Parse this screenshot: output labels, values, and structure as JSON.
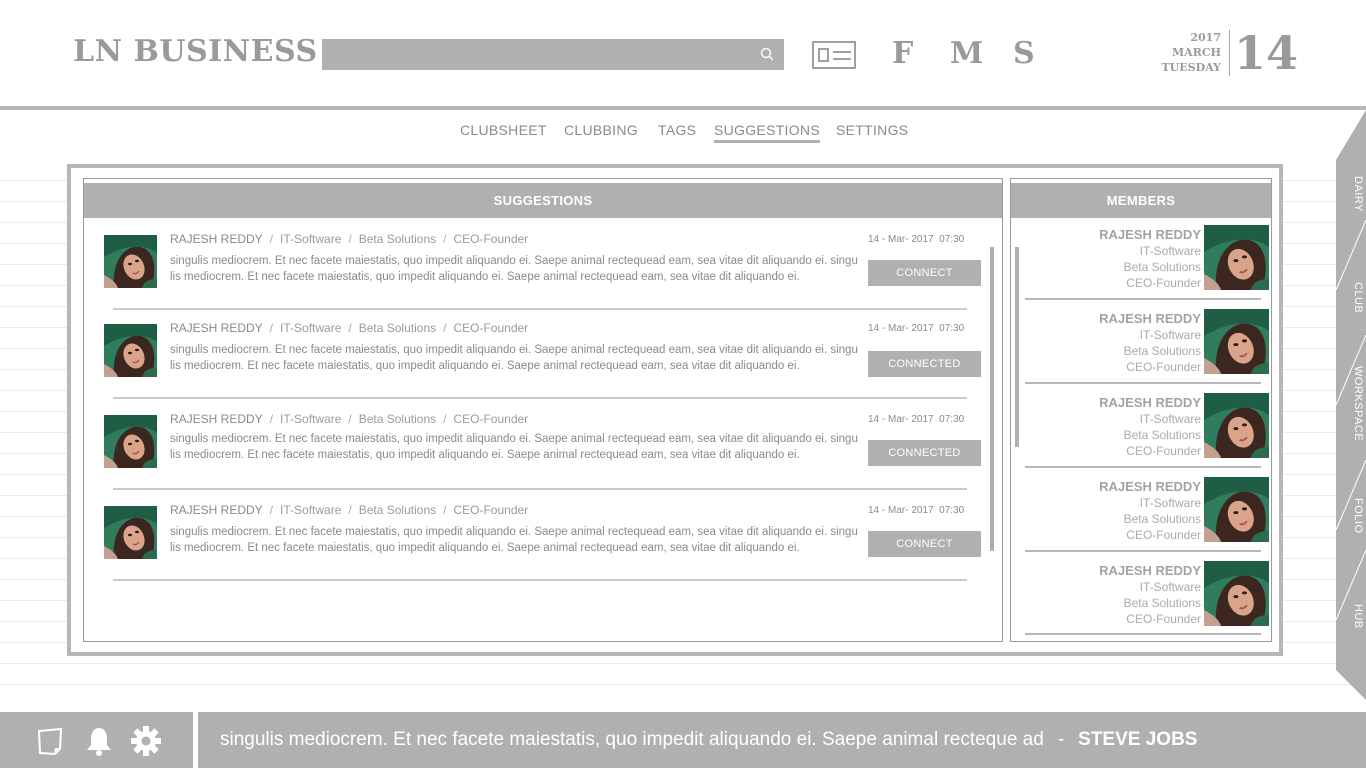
{
  "header": {
    "logo": "LN BUSINESS",
    "search_placeholder": "",
    "letters": [
      "F",
      "M",
      "S"
    ],
    "date": {
      "year": "2017",
      "month": "MARCH",
      "weekday": "TUESDAY",
      "day": "14"
    }
  },
  "nav": {
    "tabs": [
      "CLUBSHEET",
      "CLUBBING",
      "TAGS",
      "SUGGESTIONS",
      "SETTINGS"
    ],
    "active": "SUGGESTIONS"
  },
  "suggestions": {
    "title": "SUGGESTIONS",
    "items": [
      {
        "name": "RAJESH REDDY",
        "industry": "IT-Software",
        "company": "Beta Solutions",
        "role": "CEO-Founder",
        "date": "14 - Mar- 2017",
        "time": "07:30",
        "text": "singulis mediocrem. Et nec facete maiestatis, quo impedit aliquando ei. Saepe animal rectequead eam, sea vitae dit aliquando ei. singulis mediocrem. Et nec facete maiestatis, quo impedit aliquando ei. Saepe animal rectequead eam, sea vitae dit aliquando ei.",
        "action": "CONNECT"
      },
      {
        "name": "RAJESH REDDY",
        "industry": "IT-Software",
        "company": "Beta Solutions",
        "role": "CEO-Founder",
        "date": "14 - Mar- 2017",
        "time": "07:30",
        "text": "singulis mediocrem. Et nec facete maiestatis, quo impedit aliquando ei. Saepe animal rectequead eam, sea vitae dit aliquando ei. singulis mediocrem. Et nec facete maiestatis, quo impedit aliquando ei. Saepe animal rectequead eam, sea vitae dit aliquando ei.",
        "action": "CONNECTED"
      },
      {
        "name": "RAJESH REDDY",
        "industry": "IT-Software",
        "company": "Beta Solutions",
        "role": "CEO-Founder",
        "date": "14 - Mar- 2017",
        "time": "07:30",
        "text": "singulis mediocrem. Et nec facete maiestatis, quo impedit aliquando ei. Saepe animal rectequead eam, sea vitae dit aliquando ei. singulis mediocrem. Et nec facete maiestatis, quo impedit aliquando ei. Saepe animal rectequead eam, sea vitae dit aliquando ei.",
        "action": "CONNECTED"
      },
      {
        "name": "RAJESH REDDY",
        "industry": "IT-Software",
        "company": "Beta Solutions",
        "role": "CEO-Founder",
        "date": "14 - Mar- 2017",
        "time": "07:30",
        "text": "singulis mediocrem. Et nec facete maiestatis, quo impedit aliquando ei. Saepe animal rectequead eam, sea vitae dit aliquando ei. singulis mediocrem. Et nec facete maiestatis, quo impedit aliquando ei. Saepe animal rectequead eam, sea vitae dit aliquando ei.",
        "action": "CONNECT"
      }
    ]
  },
  "members": {
    "title": "MEMBERS",
    "items": [
      {
        "name": "RAJESH REDDY",
        "industry": "IT-Software",
        "company": "Beta Solutions",
        "role": "CEO-Founder"
      },
      {
        "name": "RAJESH REDDY",
        "industry": "IT-Software",
        "company": "Beta Solutions",
        "role": "CEO-Founder"
      },
      {
        "name": "RAJESH REDDY",
        "industry": "IT-Software",
        "company": "Beta Solutions",
        "role": "CEO-Founder"
      },
      {
        "name": "RAJESH REDDY",
        "industry": "IT-Software",
        "company": "Beta Solutions",
        "role": "CEO-Founder"
      },
      {
        "name": "RAJESH REDDY",
        "industry": "IT-Software",
        "company": "Beta Solutions",
        "role": "CEO-Founder"
      }
    ]
  },
  "side_tabs": [
    "DAIRY",
    "CLUB",
    "WORKSPACE",
    "FOLIO",
    "HUB"
  ],
  "footer": {
    "icons": [
      "notes-icon",
      "bell-icon",
      "gear-icon"
    ],
    "quote": "singulis mediocrem. Et nec facete maiestatis, quo impedit aliquando ei. Saepe animal recteque ad",
    "author": "STEVE JOBS"
  },
  "colors": {
    "panel_gray": "#b1b0b0",
    "text_gray": "#8a8a8a",
    "frame_gray": "#b7b7b7"
  }
}
